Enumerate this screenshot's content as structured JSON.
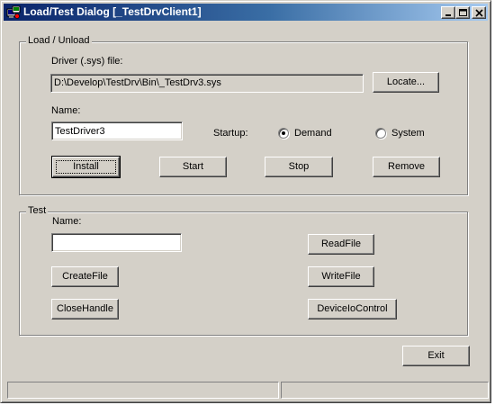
{
  "window": {
    "title": "Load/Test Dialog [_TestDrvClient1]"
  },
  "load_group": {
    "label": "Load / Unload",
    "driver_file_label": "Driver (.sys) file:",
    "driver_file_value": "D:\\Develop\\TestDrv\\Bin\\_TestDrv3.sys",
    "locate_button": "Locate...",
    "name_label": "Name:",
    "name_value": "TestDriver3",
    "startup_label": "Startup:",
    "startup_options": [
      {
        "label": "Demand",
        "selected": true
      },
      {
        "label": "System",
        "selected": false
      }
    ],
    "buttons": {
      "install": "Install",
      "start": "Start",
      "stop": "Stop",
      "remove": "Remove"
    }
  },
  "test_group": {
    "label": "Test",
    "name_label": "Name:",
    "name_value": "",
    "buttons": {
      "createfile": "CreateFile",
      "closehandle": "CloseHandle",
      "readfile": "ReadFile",
      "writefile": "WriteFile",
      "deviceiocontrol": "DeviceIoControl"
    }
  },
  "exit_button": "Exit",
  "statusbar": [
    "",
    ""
  ]
}
